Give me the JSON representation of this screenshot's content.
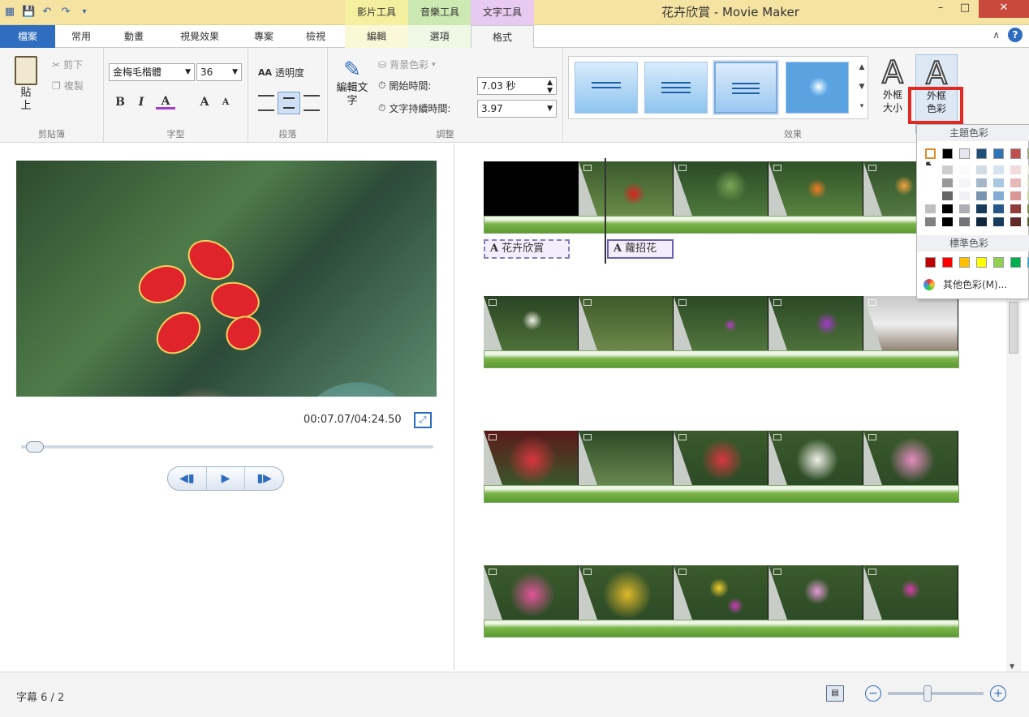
{
  "window": {
    "title": "花卉欣賞 - Movie Maker",
    "context_tabs": [
      "影片工具",
      "音樂工具",
      "文字工具"
    ],
    "controls": {
      "min": "–",
      "max": "□",
      "close": "✕"
    }
  },
  "tabs": {
    "file": "檔案",
    "home": "常用",
    "animation": "動畫",
    "visual": "視覺效果",
    "project": "專案",
    "view": "檢視",
    "edit": "編輯",
    "options": "選項",
    "format": "格式"
  },
  "ribbon": {
    "clipboard": {
      "paste": "貼上",
      "cut": "剪下",
      "copy": "複製",
      "label": "剪貼簿"
    },
    "font": {
      "family": "金梅毛楷體",
      "size": "36",
      "bold": "B",
      "italic": "I",
      "color": "A",
      "grow": "A",
      "shrink": "A",
      "label": "字型"
    },
    "paragraph": {
      "transparency": "透明度",
      "label": "段落"
    },
    "adjust": {
      "edit_text": "編輯文字",
      "bg_color": "背景色彩",
      "start_time_label": "開始時間:",
      "start_time": "7.03 秒",
      "duration_label": "文字持續時間:",
      "duration": "3.97",
      "label": "調整"
    },
    "effects": {
      "label": "效果",
      "outline_size": "外框大小",
      "outline_color": "外框色彩"
    }
  },
  "preview": {
    "timecode": "00:07.07/04:24.50"
  },
  "storyboard": {
    "captions": [
      "花卉欣賞",
      "蘿招花"
    ]
  },
  "palette": {
    "theme_label": "主題色彩",
    "standard_label": "標準色彩",
    "more_colors": "其他色彩(M)...",
    "theme_top": [
      "#ffffff",
      "#000000",
      "#e7e6f0",
      "#1f4e79",
      "#2e75b6",
      "#c0504d",
      "#9bbb59"
    ],
    "standard": [
      "#c00000",
      "#ff0000",
      "#ffc000",
      "#ffff00",
      "#92d050",
      "#00b050",
      "#00b0f0"
    ]
  },
  "status": {
    "text": "字幕 6 / 2"
  },
  "colors": {
    "accent": "#2e6dbf",
    "titlebar": "#f4e3a1",
    "highlight": "#e12b22"
  }
}
